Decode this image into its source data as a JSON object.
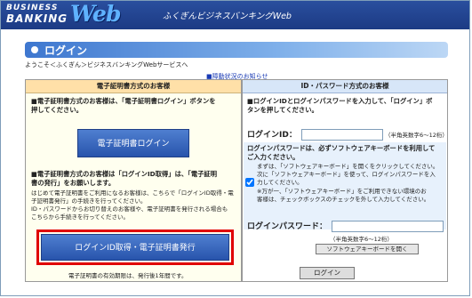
{
  "header": {
    "logo_business": "BUSINESS",
    "logo_banking": "BANKING",
    "logo_web": "Web",
    "tagline": "ふくぎんビジネスバンキングWeb"
  },
  "page": {
    "title": "ログイン",
    "breadcrumb": "ようこそ＜ふくぎん＞ビジネスバンキングWebサービスへ",
    "notice_link": "■障動状況のお知らせ"
  },
  "left": {
    "heading": "電子証明書方式のお客様",
    "p1_line1": "■電子証明書方式のお客様は、「電子証明書ログイン」ボタンを",
    "p1_line2": "押してください。",
    "cert_login_button": "電子証明書ログイン",
    "p2_line1": "■電子証明書方式のお客様は「ログインID取得」は、「電子証明",
    "p2_line2": "書の発行」をお願いします。",
    "p2_small1": "はじめて電子証明書をご利用になるお客様は、こちらで「ログインID取得・電",
    "p2_small2": "子証明書発行」の手続きを行ってください。",
    "p2_small3": "ID・パスワードからお切り替えのお客様や、電子証明書を発行される場合も",
    "p2_small4": "こちらから手続きを行ってください。",
    "login_issue_button": "ログインID取得・電子証明書発行",
    "validity": "電子証明書の有効期限は、発行後1年間です。"
  },
  "right": {
    "heading": "ID・パスワード方式のお客様",
    "intro_line1": "■ログインIDとログインパスワードを入力して、「ログイン」ボ",
    "intro_line2": "タンを押してください。",
    "login_id_label": "ログインID：",
    "login_id_value": "",
    "login_id_hint": "（半角英数字6～12桁）",
    "sw_note_line1": "ログインパスワードは、必ずソフトウェアキーボードを利用して",
    "sw_note_line2": "ご入力ください。",
    "sw_small1": "まずは、「ソフトウェアキーボード」を開くをクリックしてください。",
    "sw_small2": "次に「ソフトウェアキーボード」を使って、ログインパスワードを入",
    "sw_small3": "力してください。",
    "sw_small4": "※万が一、「ソフトウェアキーボード」をご利用できない環境のお",
    "sw_small5": "客様は、チェックボックスのチェックを外して入力してください。",
    "sw_checkbox_checked": true,
    "password_label": "ログインパスワード：",
    "password_value": "",
    "password_hint": "（半角英数字6～12桁）",
    "sw_keyboard_button": "ソフトウェアキーボードを開く",
    "login_button": "ログイン"
  },
  "colors": {
    "header_blue": "#1c3a84",
    "highlight_red": "#e00000",
    "button_blue": "#2854ac"
  }
}
